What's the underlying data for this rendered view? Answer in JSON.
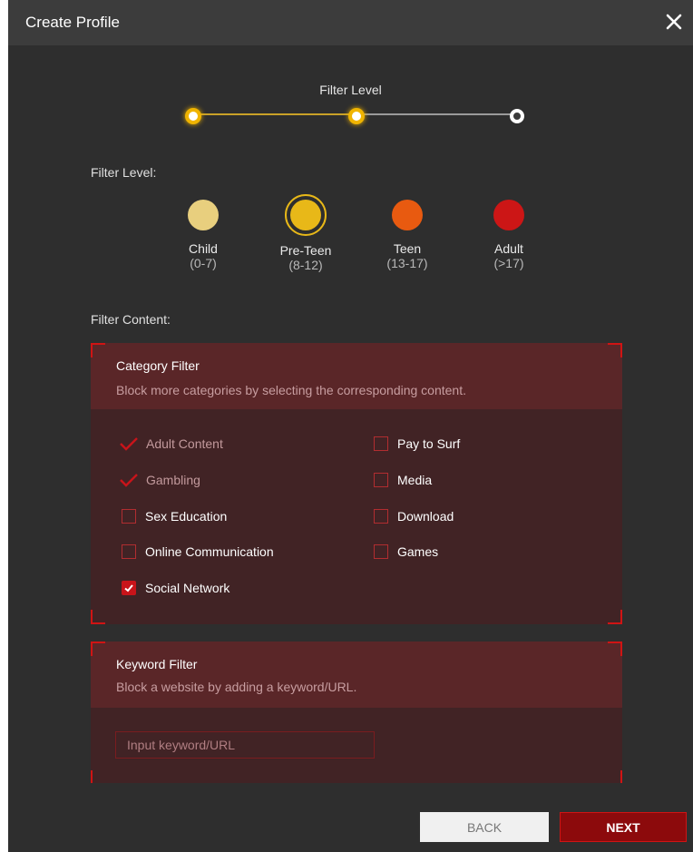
{
  "dialog": {
    "title": "Create Profile",
    "close_icon": "close-icon"
  },
  "stepper": {
    "title": "Filter Level",
    "steps_total": 3,
    "current_step": 2
  },
  "filter_level": {
    "label": "Filter Level:",
    "options": [
      {
        "name": "Child",
        "range": "(0-7)",
        "color": "#e8cf7e",
        "selected": false
      },
      {
        "name": "Pre-Teen",
        "range": "(8-12)",
        "color": "#e8b818",
        "selected": true
      },
      {
        "name": "Teen",
        "range": "(13-17)",
        "color": "#e85a10",
        "selected": false
      },
      {
        "name": "Adult",
        "range": "(>17)",
        "color": "#cc1616",
        "selected": false
      }
    ]
  },
  "filter_content": {
    "label": "Filter Content:",
    "category_filter": {
      "title": "Category Filter",
      "description": "Block more categories by selecting the corresponding content.",
      "items": [
        {
          "label": "Adult Content",
          "state": "locked-checked"
        },
        {
          "label": "Gambling",
          "state": "locked-checked"
        },
        {
          "label": "Sex Education",
          "state": "unchecked"
        },
        {
          "label": "Online Communication",
          "state": "unchecked"
        },
        {
          "label": "Social Network",
          "state": "checked"
        },
        {
          "label": "Pay to Surf",
          "state": "unchecked"
        },
        {
          "label": "Media",
          "state": "unchecked"
        },
        {
          "label": "Download",
          "state": "unchecked"
        },
        {
          "label": "Games",
          "state": "unchecked"
        }
      ]
    },
    "keyword_filter": {
      "title": "Keyword Filter",
      "description": "Block a website by adding a keyword/URL.",
      "input_placeholder": "Input keyword/URL",
      "input_value": ""
    }
  },
  "buttons": {
    "back": "BACK",
    "next": "NEXT"
  },
  "colors": {
    "accent": "#e8b818",
    "brand_red": "#d01414",
    "background": "#2e2e2e"
  }
}
